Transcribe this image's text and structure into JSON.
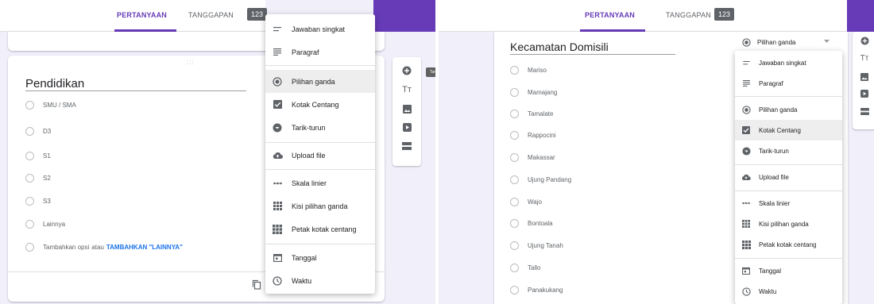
{
  "left_panel": {
    "tabs": {
      "questions": "PERTANYAAN",
      "responses": "TANGGAPAN",
      "response_count": "123"
    },
    "question": {
      "title": "Pendidikan",
      "options": [
        "SMU / SMA",
        "D3",
        "S1",
        "S2",
        "S3",
        "Lainnya"
      ],
      "add_option_text": "Tambahkan opsi",
      "add_option_or": "atau",
      "add_other_link": "TAMBAHKAN \"LAINNYA\""
    },
    "type_menu": {
      "items": [
        {
          "label": "Jawaban singkat",
          "icon": "short-answer-icon"
        },
        {
          "label": "Paragraf",
          "icon": "paragraph-icon"
        },
        {
          "label": "Pilihan ganda",
          "icon": "radio-button-icon",
          "selected": true
        },
        {
          "label": "Kotak Centang",
          "icon": "checkbox-icon"
        },
        {
          "label": "Tarik-turun",
          "icon": "dropdown-icon"
        },
        {
          "label": "Upload file",
          "icon": "cloud-upload-icon"
        },
        {
          "label": "Skala linier",
          "icon": "linear-scale-icon"
        },
        {
          "label": "Kisi pilihan ganda",
          "icon": "grid-icon"
        },
        {
          "label": "Petak kotak centang",
          "icon": "checkbox-grid-icon"
        },
        {
          "label": "Tanggal",
          "icon": "calendar-icon"
        },
        {
          "label": "Waktu",
          "icon": "clock-icon"
        }
      ]
    },
    "tooltip": "Tambahkan pertanyaan"
  },
  "right_panel": {
    "tabs": {
      "questions": "PERTANYAAN",
      "responses": "TANGGAPAN",
      "response_count": "123"
    },
    "question": {
      "title": "Kecamatan Domisili",
      "options": [
        "Mariso",
        "Mamajang",
        "Tamalate",
        "Rappocini",
        "Makassar",
        "Ujung Pandang",
        "Wajo",
        "Bontoala",
        "Ujung Tanah",
        "Tallo",
        "Panakukang"
      ]
    },
    "type_select": {
      "label": "Pilihan ganda",
      "icon": "radio-button-icon"
    },
    "type_menu": {
      "items": [
        {
          "label": "Jawaban singkat",
          "icon": "short-answer-icon"
        },
        {
          "label": "Paragraf",
          "icon": "paragraph-icon"
        },
        {
          "label": "Pilihan ganda",
          "icon": "radio-button-icon"
        },
        {
          "label": "Kotak Centang",
          "icon": "checkbox-icon",
          "selected": true
        },
        {
          "label": "Tarik-turun",
          "icon": "dropdown-icon"
        },
        {
          "label": "Upload file",
          "icon": "cloud-upload-icon"
        },
        {
          "label": "Skala linier",
          "icon": "linear-scale-icon"
        },
        {
          "label": "Kisi pilihan ganda",
          "icon": "grid-icon"
        },
        {
          "label": "Petak kotak centang",
          "icon": "checkbox-grid-icon"
        },
        {
          "label": "Tanggal",
          "icon": "calendar-icon"
        },
        {
          "label": "Waktu",
          "icon": "clock-icon"
        }
      ]
    }
  },
  "colors": {
    "accent": "#673ab7",
    "link": "#1a73e8",
    "selected_bg": "#eeeeee",
    "icon": "#5f6368"
  }
}
